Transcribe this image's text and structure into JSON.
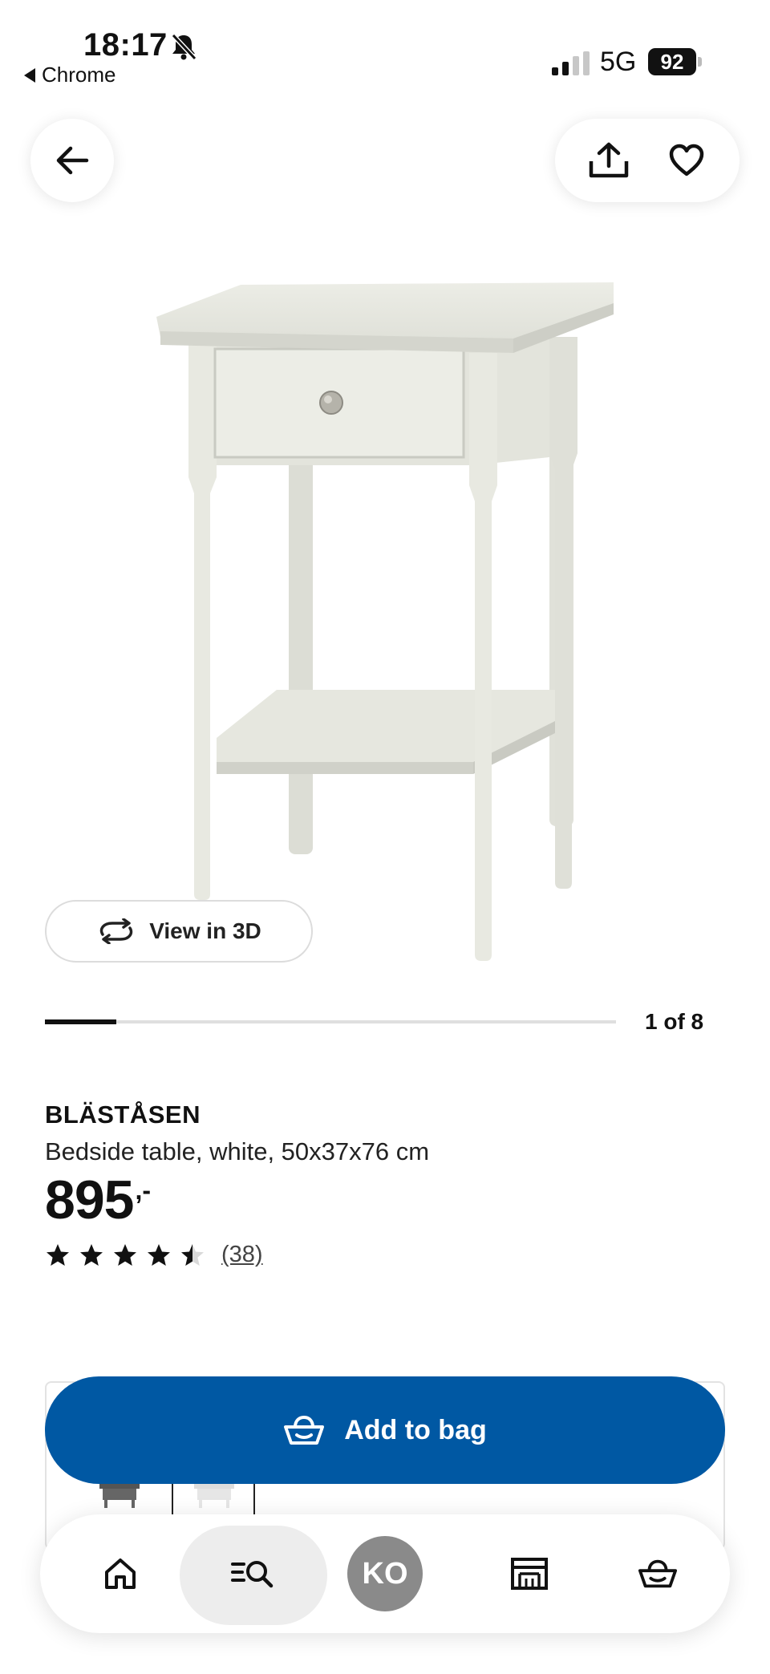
{
  "status_bar": {
    "time": "18:17",
    "back_app": "Chrome",
    "network": "5G",
    "battery": "92"
  },
  "icons": {
    "back": "arrow-left-icon",
    "share": "share-icon",
    "favorite": "heart-icon",
    "view3d": "rotate-icon",
    "bag": "shopping-bag-icon"
  },
  "gallery": {
    "view3d_label": "View in 3D",
    "counter": "1 of 8",
    "progress": 0.125
  },
  "product": {
    "name": "BLÄSTÅSEN",
    "description": "Bedside table, white, 50x37x76 cm",
    "price": "895",
    "price_suffix": ",-",
    "rating": 4.5,
    "review_count": "(38)"
  },
  "actions": {
    "add_to_bag": "Add to bag"
  },
  "bottom_nav": {
    "profile_initials": "KO"
  },
  "colors": {
    "primary": "#0058a3",
    "text": "#111111",
    "avatar": "#8a8a8a"
  }
}
